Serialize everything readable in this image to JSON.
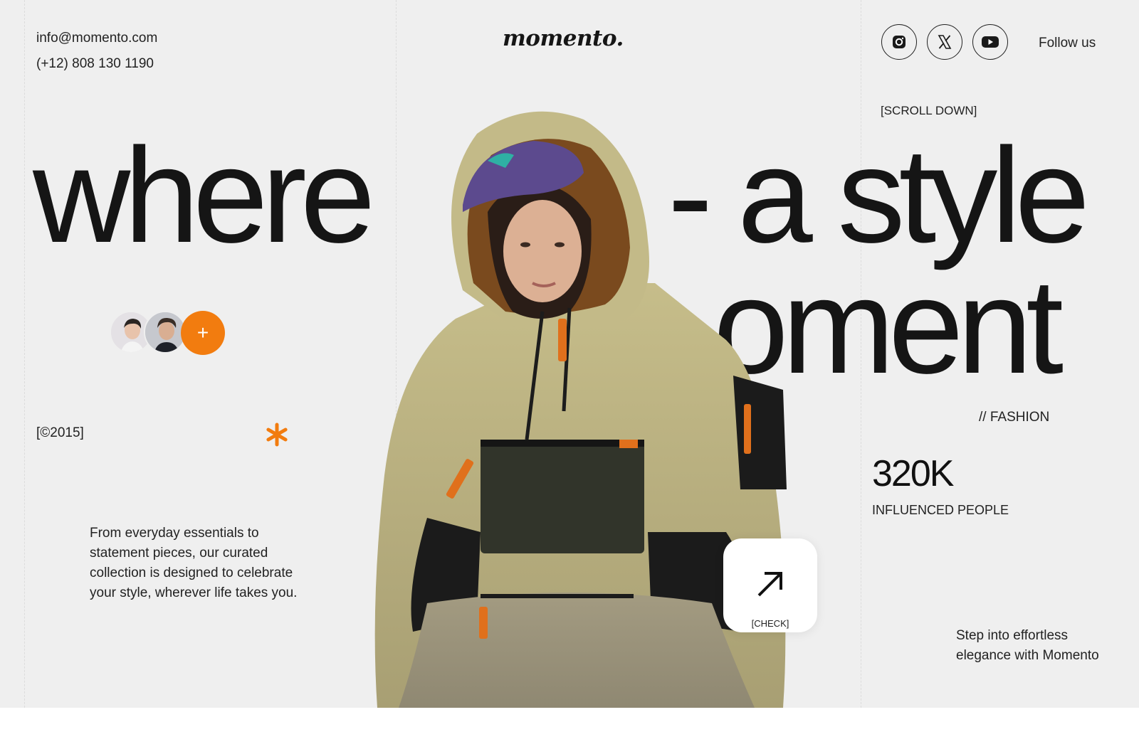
{
  "header": {
    "email": "info@momento.com",
    "phone": "(+12) 808 130 1190",
    "logo": "momento.",
    "social": [
      {
        "icon": "instagram-icon"
      },
      {
        "icon": "x-icon"
      },
      {
        "icon": "youtube-icon"
      }
    ],
    "follow_label": "Follow us"
  },
  "hero": {
    "scroll_label": "[SCROLL DOWN]",
    "headline_word_1": "where",
    "headline_word_2": "- a style",
    "headline_word_3": "oment",
    "year_label": "[©2015]",
    "description": "From everyday essentials to statement pieces, our curated collection is designed to celebrate your style, wherever life takes you.",
    "category_label": "// FASHION",
    "stat_value": "320K",
    "stat_label": "INFLUENCED PEOPLE",
    "tagline": "Step into effortless elegance with Momento",
    "check_label": "[CHECK]",
    "add_button_label": "+"
  },
  "colors": {
    "accent": "#f27c0f",
    "background": "#efefef",
    "text": "#151515"
  }
}
